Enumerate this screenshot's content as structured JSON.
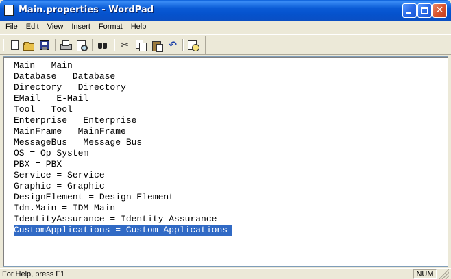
{
  "window": {
    "title": "Main.properties - WordPad",
    "controls": {
      "minimize": "minimize",
      "maximize": "maximize",
      "close": "✕"
    }
  },
  "menu": [
    "File",
    "Edit",
    "View",
    "Insert",
    "Format",
    "Help"
  ],
  "toolbar": {
    "buttons": [
      "new-icon",
      "open-icon",
      "save-icon",
      "print-icon",
      "print-preview-icon",
      "find-icon",
      "cut-icon",
      "copy-icon",
      "paste-icon",
      "undo-icon",
      "date-time-icon"
    ],
    "cut_glyph": "✂",
    "undo_glyph": "↶"
  },
  "document": {
    "lines": [
      "Main = Main",
      "Database = Database",
      "Directory = Directory",
      "EMail = E-Mail",
      "Tool = Tool",
      "Enterprise = Enterprise",
      "MainFrame = MainFrame",
      "MessageBus = Message Bus",
      "OS = Op System",
      "PBX = PBX",
      "Service = Service",
      "Graphic = Graphic",
      "DesignElement = Design Element",
      "Idm.Main = IDM Main",
      "IdentityAssurance = Identity Assurance",
      "CustomApplications = Custom Applications"
    ],
    "selected_line": 15,
    "selection_color": "#316AC5"
  },
  "status": {
    "help_text": "For Help, press F1",
    "num_indicator": "NUM"
  }
}
